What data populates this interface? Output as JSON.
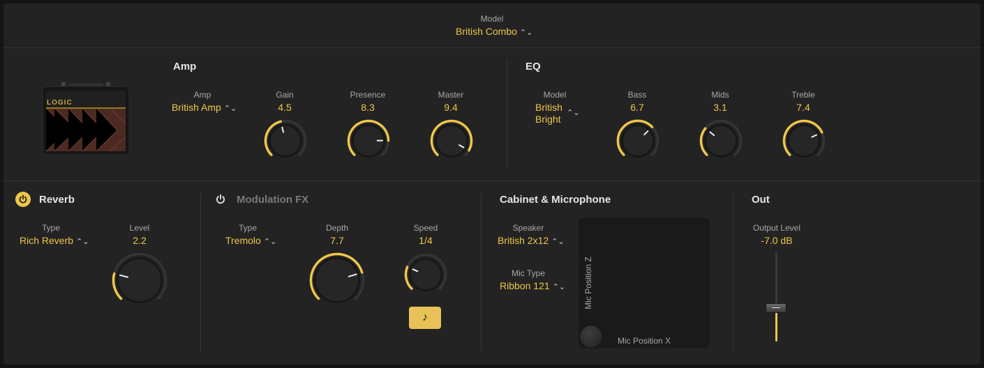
{
  "header": {
    "model_label": "Model",
    "model_value": "British Combo"
  },
  "colors": {
    "accent": "#f0c64a",
    "panel": "#232323",
    "knob": "#2a2a2a"
  },
  "amp": {
    "title": "Amp",
    "logo_text": "LOGIC",
    "amp_label": "Amp",
    "amp_value": "British Amp",
    "gain": {
      "label": "Gain",
      "value": "4.5",
      "fraction": 0.45
    },
    "presence": {
      "label": "Presence",
      "value": "8.3",
      "fraction": 0.83
    },
    "master": {
      "label": "Master",
      "value": "9.4",
      "fraction": 0.94
    }
  },
  "eq": {
    "title": "EQ",
    "model_label": "Model",
    "model_line1": "British",
    "model_line2": "Bright",
    "bass": {
      "label": "Bass",
      "value": "6.7",
      "fraction": 0.67
    },
    "mids": {
      "label": "Mids",
      "value": "3.1",
      "fraction": 0.31
    },
    "treble": {
      "label": "Treble",
      "value": "7.4",
      "fraction": 0.74
    }
  },
  "reverb": {
    "title": "Reverb",
    "enabled": true,
    "type_label": "Type",
    "type_value": "Rich Reverb",
    "level": {
      "label": "Level",
      "value": "2.2",
      "fraction": 0.22
    }
  },
  "modulation": {
    "title": "Modulation FX",
    "enabled": false,
    "type_label": "Type",
    "type_value": "Tremolo",
    "depth": {
      "label": "Depth",
      "value": "7.7",
      "fraction": 0.77
    },
    "speed": {
      "label": "Speed",
      "value": "1/4",
      "fraction": 0.25
    },
    "sync_icon": "music-note-icon"
  },
  "cabinet": {
    "title": "Cabinet & Microphone",
    "speaker_label": "Speaker",
    "speaker_value": "British 2x12",
    "mic_type_label": "Mic Type",
    "mic_type_value": "Ribbon 121",
    "mic_pos_z_label": "Mic Position Z",
    "mic_pos_x_label": "Mic Position X"
  },
  "out": {
    "title": "Out",
    "output_level_label": "Output Level",
    "output_level_value": "-7.0 dB",
    "fader_fraction": 0.38
  }
}
